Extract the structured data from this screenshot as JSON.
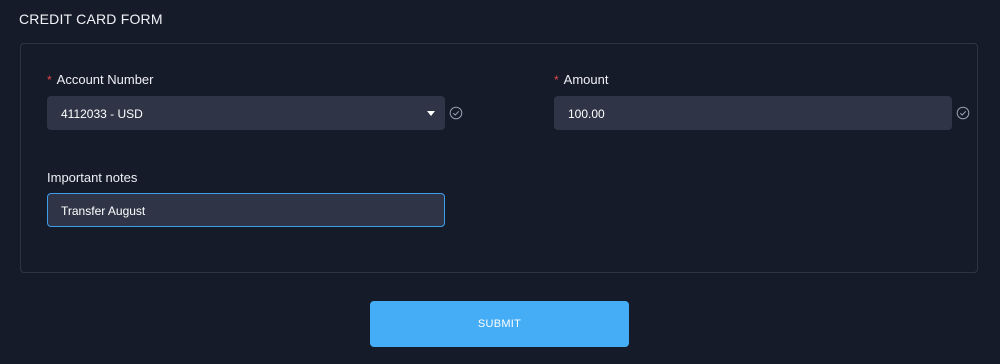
{
  "page": {
    "title": "CREDIT CARD FORM"
  },
  "form": {
    "account_number": {
      "label": "Account Number",
      "required_marker": "*",
      "value": "4112033 - USD",
      "valid": true
    },
    "amount": {
      "label": "Amount",
      "required_marker": "*",
      "value": "100.00",
      "valid": true
    },
    "notes": {
      "label": "Important notes",
      "value": "Transfer August",
      "focused": true
    },
    "submit_label": "SUBMIT"
  },
  "colors": {
    "background": "#161b29",
    "field_background": "#2f3547",
    "required_star": "#e0454b",
    "focus_border": "#3d9dea",
    "submit_button": "#45acf6"
  },
  "icons": {
    "dropdown": "caret-down-icon",
    "validation": "check-circle-icon"
  }
}
